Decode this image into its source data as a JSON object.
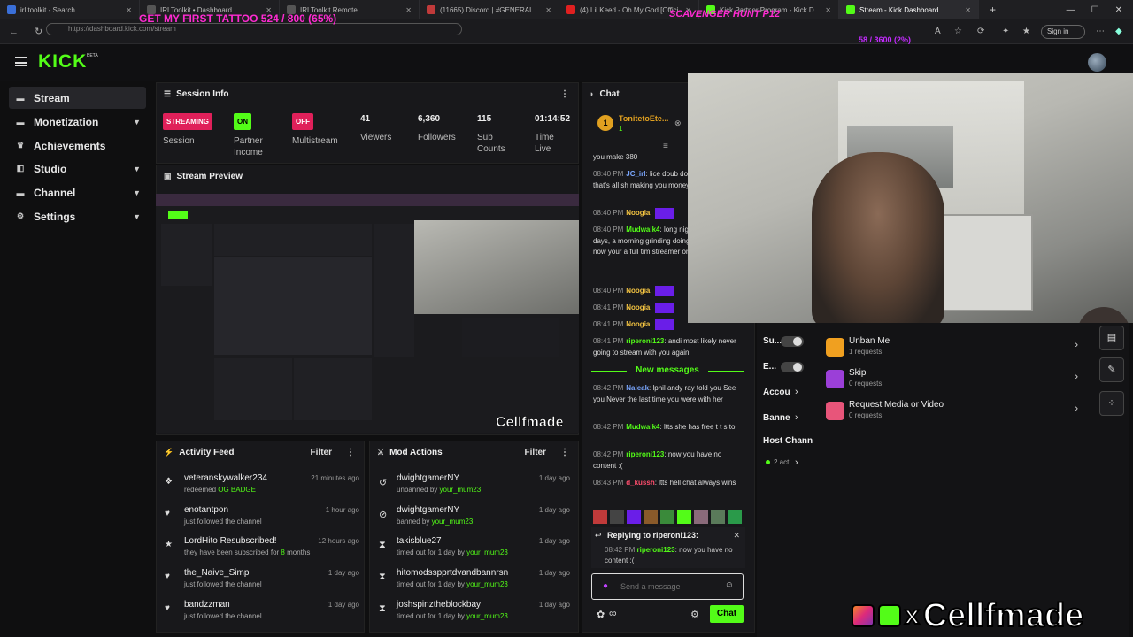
{
  "browser": {
    "tabs": [
      {
        "label": "irl toolkit - Search",
        "active": false
      },
      {
        "label": "IRLToolkit • Dashboard",
        "active": false
      },
      {
        "label": "IRLToolkit Remote",
        "active": false
      },
      {
        "label": "(11665) Discord | #GENERAL | Cellf",
        "active": false
      },
      {
        "label": "(4) Lil Keed - Oh My God [Offici",
        "active": false
      },
      {
        "label": "Kick Partner Program - Kick Dash",
        "active": false
      },
      {
        "label": "Stream - Kick Dashboard",
        "active": true
      }
    ],
    "url": "https://dashboard.kick.com/stream",
    "sign_in": "Sign in"
  },
  "overlays": {
    "tattoo_goal": "GET MY FIRST TATTOO 524 / 800 (65%)",
    "scavenger": "SCAVENGER HUNT P12",
    "goal2": "58 / 3600 (2%)"
  },
  "header": {
    "logo": "KICK",
    "beta": "BETA"
  },
  "sidebar": {
    "items": [
      {
        "label": "Stream",
        "icon": "video-icon",
        "chevron": false,
        "active": true
      },
      {
        "label": "Monetization",
        "icon": "money-icon",
        "chevron": true,
        "active": false
      },
      {
        "label": "Achievements",
        "icon": "trophy-icon",
        "chevron": false,
        "active": false
      },
      {
        "label": "Studio",
        "icon": "studio-icon",
        "chevron": true,
        "active": false
      },
      {
        "label": "Channel",
        "icon": "channel-icon",
        "chevron": true,
        "active": false
      },
      {
        "label": "Settings",
        "icon": "gear-icon",
        "chevron": true,
        "active": false
      }
    ]
  },
  "session_info": {
    "title": "Session Info",
    "session_badge": "STREAMING",
    "session_label": "Session",
    "partner_badge": "ON",
    "partner_label": "Partner Income",
    "multistream_badge": "OFF",
    "multistream_label": "Multistream",
    "viewers": "41",
    "viewers_label": "Viewers",
    "followers": "6,360",
    "followers_label": "Followers",
    "subs": "115",
    "subs_label": "Sub Counts",
    "time": "01:14:52",
    "time_label": "Time Live"
  },
  "stream_preview": {
    "title": "Stream Preview",
    "watermark": "Cellfmade"
  },
  "activity_feed": {
    "title": "Activity Feed",
    "filter": "Filter",
    "items": [
      {
        "icon": "gift-icon",
        "name": "veteranskywalker234",
        "pre": "redeemed ",
        "hl": "OG BADGE",
        "post": "",
        "time": "21 minutes ago"
      },
      {
        "icon": "heart-icon",
        "name": "enotantpon",
        "pre": "just followed the channel",
        "hl": "",
        "post": "",
        "time": "1 hour ago"
      },
      {
        "icon": "star-icon",
        "name": "LordHito Resubscribed!",
        "pre": "they have been subscribed for ",
        "hl": "8",
        "post": " months",
        "time": "12 hours ago"
      },
      {
        "icon": "heart-icon",
        "name": "the_Naive_Simp",
        "pre": "just followed the channel",
        "hl": "",
        "post": "",
        "time": "1 day ago"
      },
      {
        "icon": "heart-icon",
        "name": "bandzzman",
        "pre": "just followed the channel",
        "hl": "",
        "post": "",
        "time": "1 day ago"
      }
    ]
  },
  "mod_actions": {
    "title": "Mod Actions",
    "filter": "Filter",
    "items": [
      {
        "icon": "unban-icon",
        "glyph": "↺",
        "name": "dwightgamerNY",
        "pre": "unbanned by ",
        "by": "your_mum23",
        "time": "1 day ago"
      },
      {
        "icon": "ban-icon",
        "glyph": "⊘",
        "name": "dwightgamerNY",
        "pre": "banned by ",
        "by": "your_mum23",
        "time": "1 day ago"
      },
      {
        "icon": "hourglass-icon",
        "glyph": "⧗",
        "name": "takisblue27",
        "pre": "timed out for 1 day by ",
        "by": "your_mum23",
        "time": "1 day ago"
      },
      {
        "icon": "hourglass-icon",
        "glyph": "⧗",
        "name": "hitomodsspprtdvandbannrsn",
        "pre": "timed out for 1 day by ",
        "by": "your_mum23",
        "time": "1 day ago"
      },
      {
        "icon": "hourglass-icon",
        "glyph": "⧗",
        "name": "joshspinztheblockbay",
        "pre": "timed out for 1 day by ",
        "by": "your_mum23",
        "time": "1 day ago"
      }
    ]
  },
  "chat": {
    "title": "Chat",
    "pinned_user": "TonitetoEte...",
    "pinned_count": "1",
    "messages": [
      {
        "time": "",
        "user": "",
        "color": "#ddd",
        "text": "you make 380"
      },
      {
        "time": "08:40 PM",
        "user": "JC_irl",
        "color": "#7aa7ff",
        "text": "lice doub double you pimp that's all sh making you money"
      },
      {
        "time": "08:40 PM",
        "user": "Noogia",
        "color": "#f5c542",
        "text": ""
      },
      {
        "time": "08:40 PM",
        "user": "Mudwalk4",
        "color": "#53fc18",
        "text": "long nights and hard days, a morning grinding doing real payed off, now your a full tim streamer or just troll people"
      },
      {
        "time": "08:40 PM",
        "user": "Noogia",
        "color": "#f5c542",
        "text": ""
      },
      {
        "time": "08:41 PM",
        "user": "Noogia",
        "color": "#f5c542",
        "text": ""
      },
      {
        "time": "08:41 PM",
        "user": "Noogia",
        "color": "#f5c542",
        "text": ""
      },
      {
        "time": "08:41 PM",
        "user": "riperoni123",
        "color": "#53fc18",
        "text": "andi most likely never going to stream with you again"
      }
    ],
    "new_messages": "New messages",
    "new": [
      {
        "time": "08:42 PM",
        "user": "Naleak",
        "color": "#7aa7ff",
        "text": "lphil andy ray told you See you Never the last time you were with her"
      },
      {
        "time": "08:42 PM",
        "user": "Mudwalk4",
        "color": "#53fc18",
        "text": "ltts she has free t t s to"
      },
      {
        "time": "08:42 PM",
        "user": "riperoni123",
        "color": "#53fc18",
        "text": "now you have no content :("
      },
      {
        "time": "08:43 PM",
        "user": "d_kussh",
        "color": "#ff4d6d",
        "text": "ltts hell chat always wins"
      }
    ],
    "reply_label": "Replying to riperoni123:",
    "reply_time": "08:42 PM",
    "reply_user": "riperoni123",
    "reply_text": "now you have no content :(",
    "input_placeholder": "Send a message",
    "send": "Chat"
  },
  "settings_panel": {
    "toggles": [
      {
        "label": "Su..."
      },
      {
        "label": "E..."
      }
    ],
    "links": [
      {
        "label": "Accou"
      },
      {
        "label": "Banne"
      }
    ],
    "host_label": "Host Chann",
    "active_label": "2 act"
  },
  "queue": [
    {
      "name": "Unban Me",
      "sub": "1 requests",
      "color": "#f0a020",
      "icon": "unban-request-icon"
    },
    {
      "name": "Skip",
      "sub": "0 requests",
      "color": "#9b3fd8",
      "icon": "skip-icon"
    },
    {
      "name": "Request Media or Video",
      "sub": "0 requests",
      "color": "#e8557a",
      "icon": "media-icon"
    }
  ],
  "bottom_watermark": "Cellfmade"
}
